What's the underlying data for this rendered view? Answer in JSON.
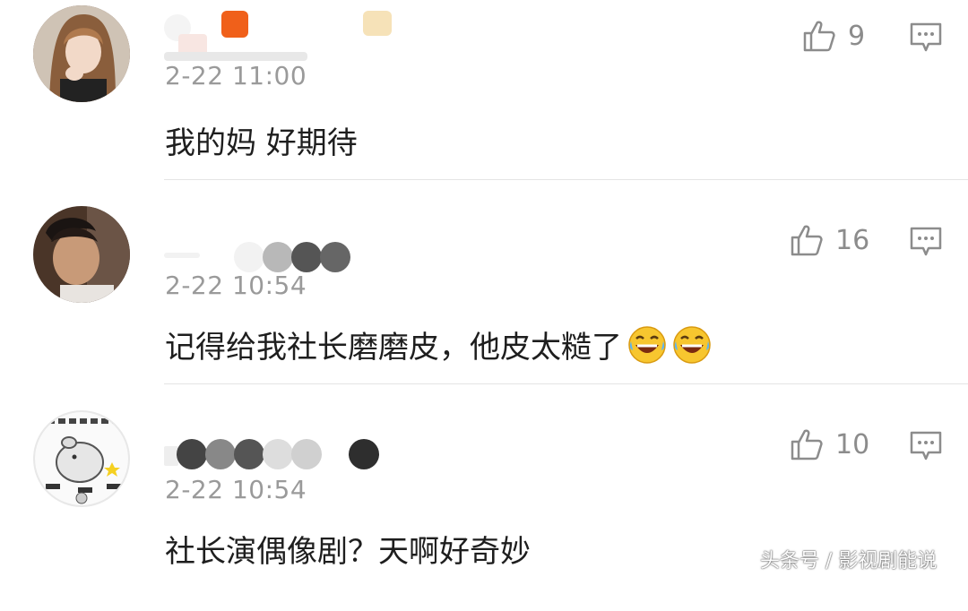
{
  "comments": [
    {
      "time": "2-22 11:00",
      "text": "我的妈 好期待",
      "likes": "9",
      "avatar": "avatar-girl"
    },
    {
      "time": "2-22 10:54",
      "text": "记得给我社长磨磨皮，他皮太糙了",
      "likes": "16",
      "avatar": "avatar-man",
      "emojis": [
        "laughing-tears-emoji",
        "laughing-tears-emoji"
      ]
    },
    {
      "time": "2-22 10:54",
      "text": "社长演偶像剧？天啊好奇妙",
      "likes": "10",
      "avatar": "avatar-cartoon-hamster"
    }
  ],
  "icons": {
    "like": "thumbs-up-icon",
    "reply": "comment-bubble-icon"
  },
  "colors": {
    "text": "#1e1e1e",
    "meta": "#9a9a9a",
    "icon": "#8c8c8c",
    "divider": "#e4e4e4"
  },
  "watermark": "头条号 / 影视剧能说"
}
